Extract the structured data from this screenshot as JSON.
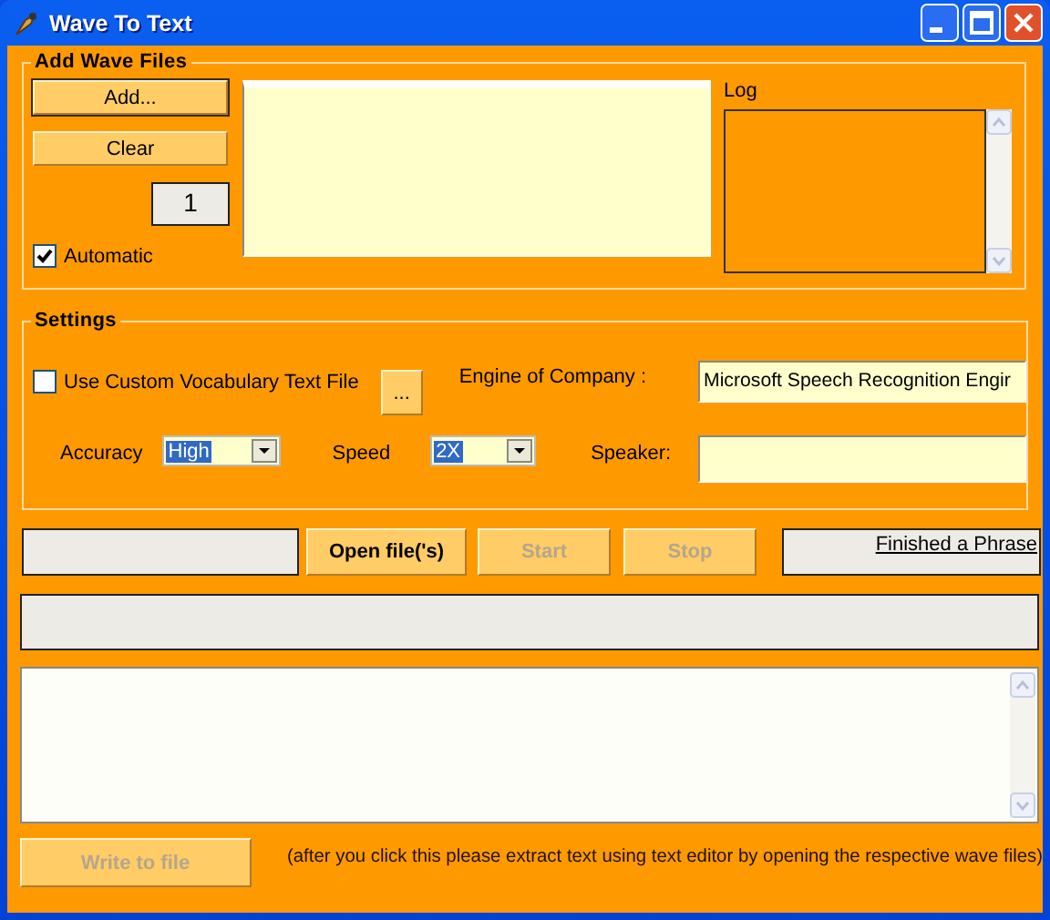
{
  "window": {
    "title": "Wave To Text"
  },
  "add_wave_files": {
    "title": "Add Wave Files",
    "buttons": [
      {
        "label": "Add...",
        "default": true
      },
      {
        "label": "Clear",
        "default": false
      }
    ],
    "count": "1",
    "automatic": {
      "label": "Automatic",
      "checked": true
    },
    "log_label": "Log"
  },
  "settings": {
    "title": "Settings",
    "custom_vocabulary": {
      "label": "Use Custom Vocabulary Text File",
      "checked": false
    },
    "browse_button": "...",
    "engine_label": "Engine of Company :",
    "engine_value": "Microsoft Speech Recognition Engir",
    "accuracy": {
      "label": "Accuracy",
      "value": "High"
    },
    "speed": {
      "label": "Speed",
      "value": "2X"
    },
    "speaker_label": "Speaker:"
  },
  "actions": [
    {
      "label": "Open file('s)",
      "disabled": false
    },
    {
      "label": "Start",
      "disabled": true
    },
    {
      "label": "Stop",
      "disabled": true
    }
  ],
  "status_link": "Finished a Phrase",
  "write_button": {
    "label": "Write to file",
    "disabled": true
  },
  "note": "(after you click this please extract text using text editor by opening the respective wave files)"
}
